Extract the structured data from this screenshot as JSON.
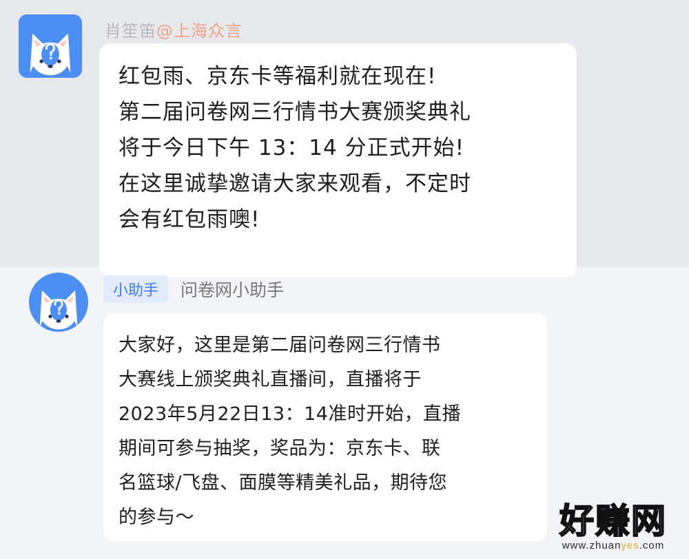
{
  "messages": [
    {
      "sender": "肖笙笛",
      "mention": "@上海众言",
      "text": "红包雨、京东卡等福利就在现在!\n第二届问卷网三行情书大赛颁奖典礼\n将于今日下午 13：14 分正式开始!\n在这里诚挚邀请大家来观看，不定时\n会有红包雨噢!"
    },
    {
      "badge": "小助手",
      "sender": "问卷网小助手",
      "text": "大家好，这里是第二届问卷网三行情书\n大赛线上颁奖典礼直播间，直播将于\n2023年5月22日13：14准时开始，直播\n期间可参与抽奖，奖品为：京东卡、联\n名篮球/飞盘、面膜等精美礼品，期待您\n的参与～"
    }
  ],
  "watermark": {
    "title": "好赚网",
    "url_prefix": "www.zhuan",
    "url_highlight": "yes",
    "url_suffix": ".com"
  },
  "colors": {
    "avatar_blue": "#4b8ff5",
    "badge_text": "#3c7cf2",
    "mention": "#f0a285"
  },
  "icons": {
    "avatar": "fox-question-avatar"
  }
}
